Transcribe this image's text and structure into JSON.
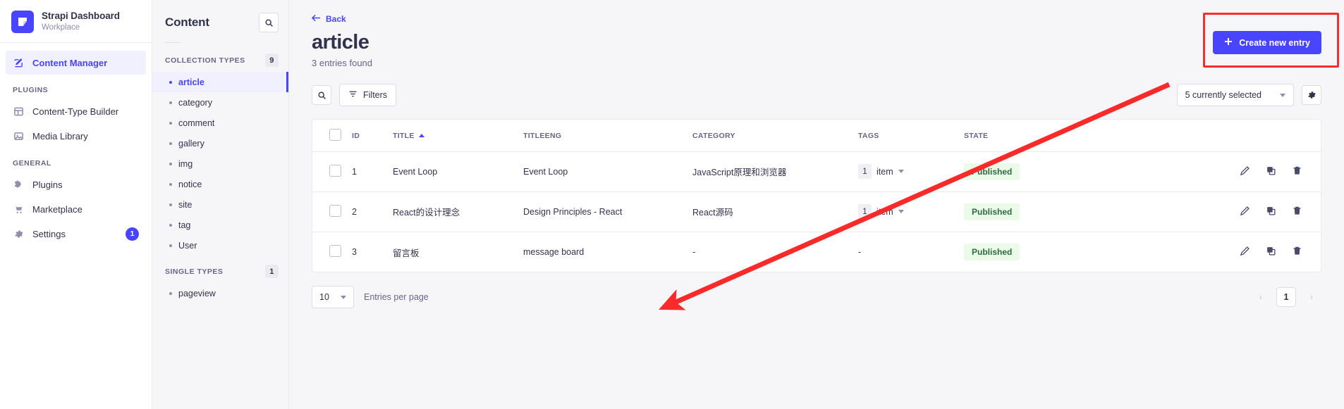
{
  "brand": {
    "title": "Strapi Dashboard",
    "subtitle": "Workplace",
    "logo_color": "#4945ff"
  },
  "leftnav": {
    "primary": {
      "label": "Content Manager",
      "icon": "pencil-square-icon"
    },
    "plugins_label": "PLUGINS",
    "plugins": [
      {
        "label": "Content-Type Builder",
        "icon": "layout-icon"
      },
      {
        "label": "Media Library",
        "icon": "image-icon"
      }
    ],
    "general_label": "GENERAL",
    "general": [
      {
        "label": "Plugins",
        "icon": "puzzle-icon",
        "badge": ""
      },
      {
        "label": "Marketplace",
        "icon": "cart-icon",
        "badge": ""
      },
      {
        "label": "Settings",
        "icon": "gear-icon",
        "badge": "1"
      }
    ]
  },
  "content_panel": {
    "title": "Content",
    "search_icon": "search-icon",
    "collection_types_label": "COLLECTION TYPES",
    "collection_types_count": "9",
    "collection_types": [
      {
        "label": "article",
        "active": true
      },
      {
        "label": "category",
        "active": false
      },
      {
        "label": "comment",
        "active": false
      },
      {
        "label": "gallery",
        "active": false
      },
      {
        "label": "img",
        "active": false
      },
      {
        "label": "notice",
        "active": false
      },
      {
        "label": "site",
        "active": false
      },
      {
        "label": "tag",
        "active": false
      },
      {
        "label": "User",
        "active": false
      }
    ],
    "single_types_label": "SINGLE TYPES",
    "single_types_count": "1",
    "single_types": [
      {
        "label": "pageview",
        "active": false
      }
    ]
  },
  "main": {
    "back_label": "Back",
    "page_title": "article",
    "entries_found": "3 entries found",
    "create_button": "Create new entry",
    "create_button_color": "#4945ff",
    "annotation_color": "#fb2c2c",
    "toolbar": {
      "search_icon": "search-icon",
      "filters_label": "Filters",
      "fields_select": "5 currently selected",
      "settings_icon": "gear-icon"
    },
    "table": {
      "columns": [
        "ID",
        "TITLE",
        "TITLEENG",
        "CATEGORY",
        "TAGS",
        "STATE"
      ],
      "sorted_column": "TITLE",
      "sort_direction": "asc",
      "rows": [
        {
          "id": "1",
          "title": "Event Loop",
          "titleeng": "Event Loop",
          "category": "JavaScript原理和浏览器",
          "tags_count": "1",
          "tags_word": "item",
          "state": "Published"
        },
        {
          "id": "2",
          "title": "React的设计理念",
          "titleeng": "Design Principles - React",
          "category": "React源码",
          "tags_count": "1",
          "tags_word": "item",
          "state": "Published"
        },
        {
          "id": "3",
          "title": "留言板",
          "titleeng": "message board",
          "category": "-",
          "tags_count": "",
          "tags_word": "-",
          "state": "Published"
        }
      ],
      "row_action_icons": [
        "edit-pencil-icon",
        "duplicate-icon",
        "trash-icon"
      ]
    },
    "footer": {
      "entries_per_page_value": "10",
      "entries_per_page_label": "Entries per page",
      "current_page": "1",
      "prev_label": "‹",
      "next_label": "›"
    }
  }
}
